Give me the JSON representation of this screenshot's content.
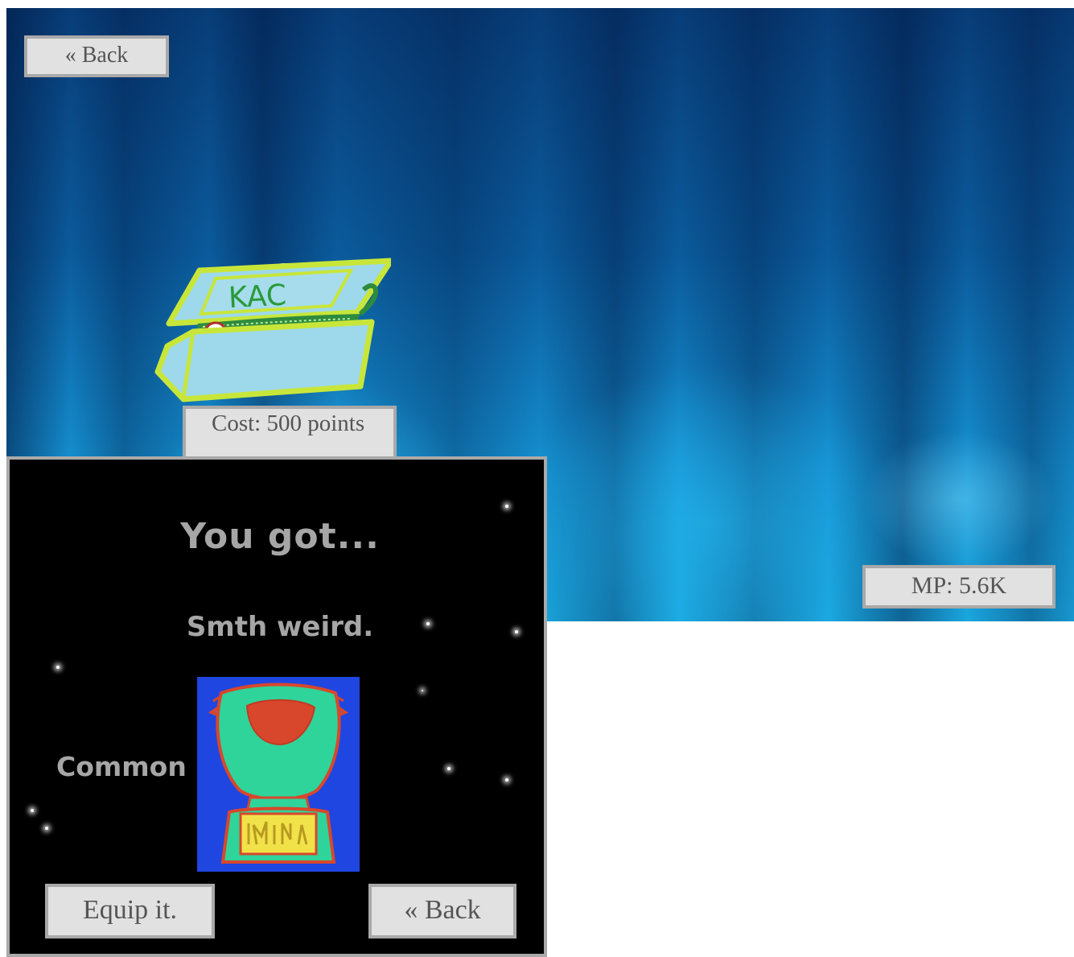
{
  "scene": {
    "back_button": "« Back",
    "chest": {
      "label": "KAC",
      "cost": "Cost: 500 points"
    },
    "mp": "MP: 5.6K"
  },
  "reward_popup": {
    "title": "You got...",
    "item_name": "Smth weird.",
    "rarity": "Common",
    "equip_button": "Equip it.",
    "back_button": "« Back"
  },
  "colors": {
    "button_bg": "#e1e1e1",
    "button_border": "#a9a9a9",
    "button_text": "#555555",
    "popup_bg": "#000000",
    "popup_text": "#a6a6a6",
    "chest_fill": "#9dd9ea",
    "chest_outline": "#c8e63a"
  }
}
